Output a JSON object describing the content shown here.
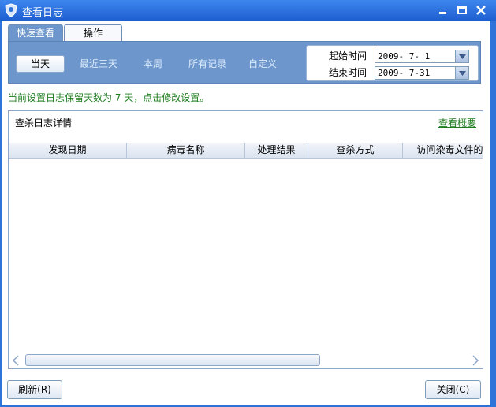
{
  "window": {
    "title": "查看日志"
  },
  "tabs": [
    {
      "label": "快速查看",
      "active": true
    },
    {
      "label": "操作",
      "active": false
    }
  ],
  "filters": {
    "today": "当天",
    "last3days": "最近三天",
    "this_week": "本周",
    "all_records": "所有记录",
    "custom": "自定义"
  },
  "dates": {
    "start_label": "起始时间",
    "start_value": "2009- 7- 1",
    "end_label": "结束时间",
    "end_value": "2009- 7-31"
  },
  "notice": "当前设置日志保留天数为 7 天，点击修改设置。",
  "panel": {
    "title": "查杀日志详情",
    "summary_link": "查看概要",
    "columns": [
      "发现日期",
      "病毒名称",
      "处理结果",
      "查杀方式",
      "访问染毒文件的"
    ],
    "rows": []
  },
  "buttons": {
    "refresh": "刷新(R)",
    "close": "关闭(C)"
  },
  "colors": {
    "titlebar": "#2f73d8",
    "filter_bar": "#6d97cc",
    "notice_text": "#1f7d1f"
  }
}
